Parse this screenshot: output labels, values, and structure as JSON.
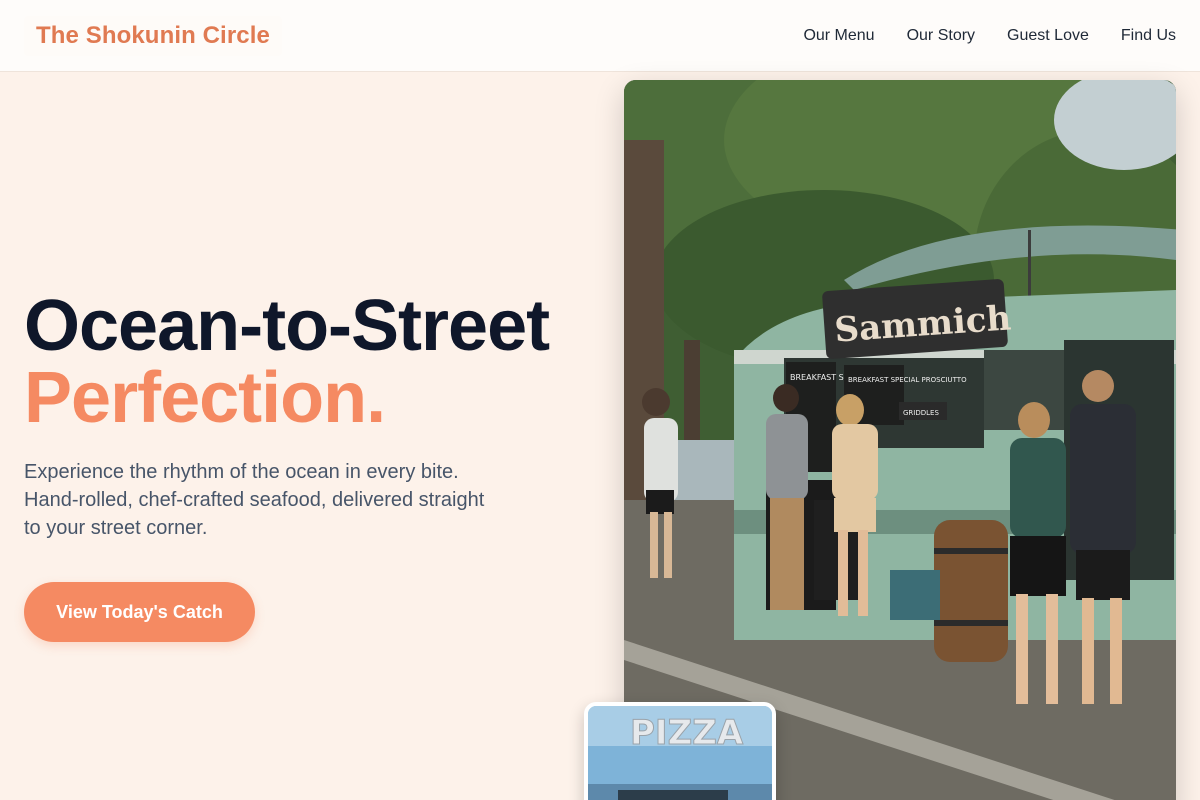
{
  "header": {
    "brand": "The Shokunin Circle",
    "nav": [
      {
        "label": "Our Menu"
      },
      {
        "label": "Our Story"
      },
      {
        "label": "Guest Love"
      },
      {
        "label": "Find Us"
      }
    ]
  },
  "hero": {
    "title_line1": "Ocean-to-Street",
    "title_line2": "Perfection.",
    "subtitle": "Experience the rhythm of the ocean in every bite. Hand-rolled, chef-crafted seafood, delivered straight to your street corner.",
    "cta_label": "View Today's Catch"
  },
  "photos": {
    "main": {
      "truck_sign": "Sammich",
      "board_left": "BREAKFAST SAMMICHES",
      "board_right": "BREAKFAST SPECIAL PROSCIUTTO",
      "board_small": "GRIDDLES"
    },
    "mini": {
      "sign": "PIZZA"
    }
  },
  "colors": {
    "accent": "#f58a62",
    "brand": "#e07a52",
    "heading": "#0f172a",
    "body_text": "#475569",
    "page_bg": "#fdf2ea"
  }
}
